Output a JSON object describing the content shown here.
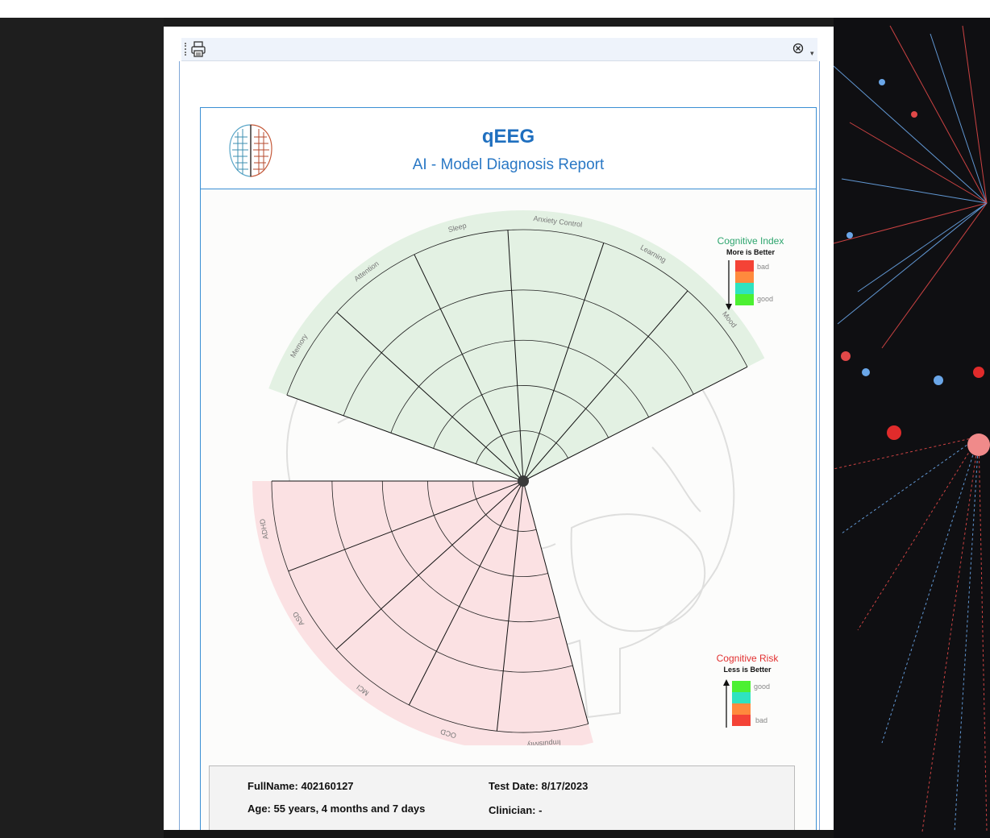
{
  "viewer": {
    "toolbar": {
      "print_icon": "printer-icon",
      "close_icon": "circle-x-icon",
      "more_icon": "chevron-down-icon"
    }
  },
  "report": {
    "title": "qEEG",
    "subtitle": "AI - Model Diagnosis Report",
    "logo_icon": "brain-logo-icon"
  },
  "cognitive_index": {
    "title": "Cognitive Index",
    "subtitle": "More is Better",
    "bad_label": "bad",
    "good_label": "good",
    "colors": [
      "#f44336",
      "#ff8a3d",
      "#2fe3c0",
      "#4cf032"
    ]
  },
  "cognitive_risk": {
    "title": "Cognitive Risk",
    "subtitle": "Less is Better",
    "good_label": "good",
    "bad_label": "bad",
    "colors": [
      "#4cf032",
      "#2fe3c0",
      "#ff8a3d",
      "#f44336"
    ]
  },
  "chart_data": {
    "type": "polar-area",
    "index_categories": [
      "Memory",
      "Attention",
      "Sleep",
      "Anxiety Control",
      "Learning",
      "Mood"
    ],
    "risk_categories": [
      "ADHD",
      "ASD",
      "MCI",
      "OCD",
      "Impulsivity"
    ],
    "index_sector_color": "#e3f1e3",
    "risk_sector_color": "#fbe1e3"
  },
  "patient": {
    "fullname_label": "FullName:",
    "fullname_value": "402160127",
    "age_label": "Age:",
    "age_value": "55 years, 4 months and 7 days",
    "testdate_label": "Test Date:",
    "testdate_value": "8/17/2023",
    "clinician_label": "Clinician:",
    "clinician_value": "-"
  }
}
